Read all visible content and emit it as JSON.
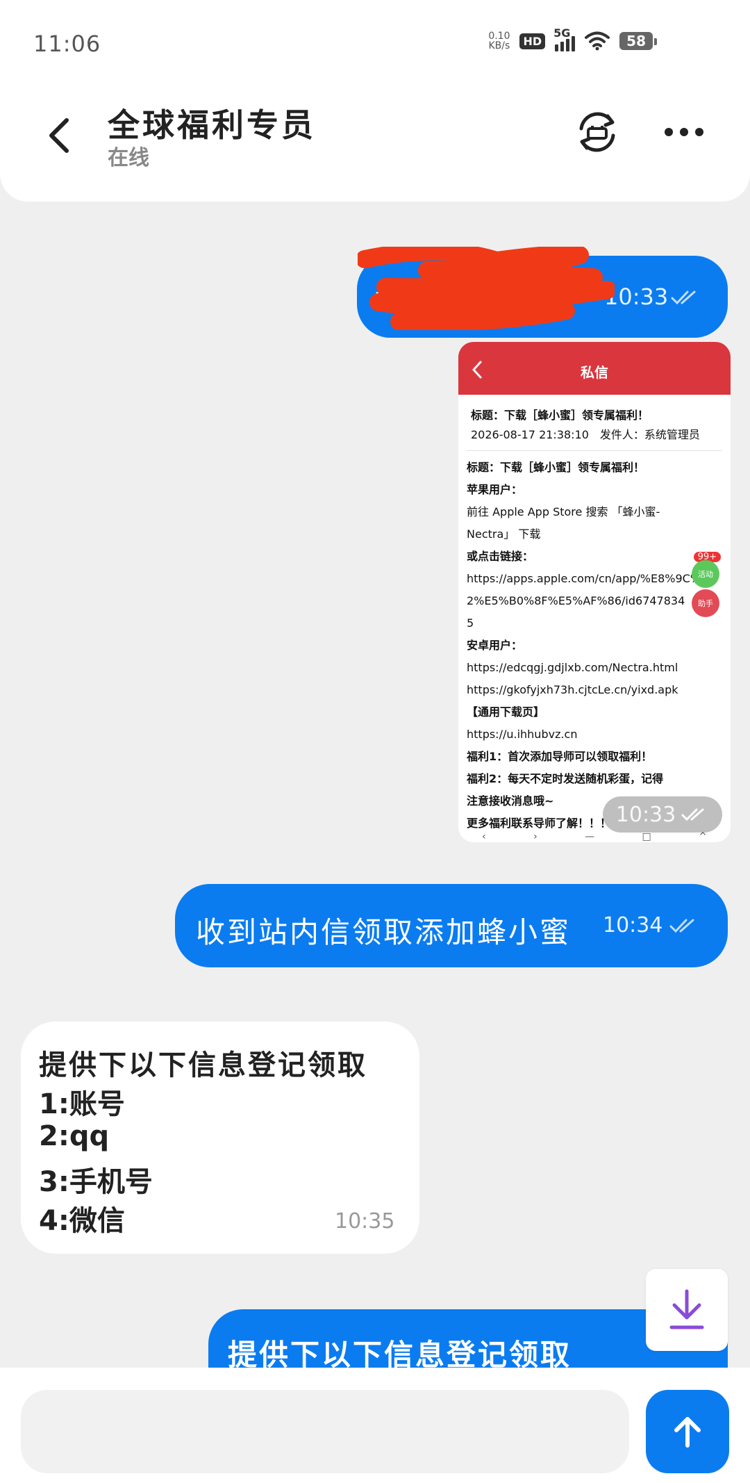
{
  "status_bar": {
    "time": "11:06",
    "net_speed_value": "0.10",
    "net_speed_unit": "KB/s",
    "hd_label": "HD",
    "network_label": "5G",
    "battery": "58"
  },
  "header": {
    "contact_name": "全球福利专员",
    "contact_status": "在线"
  },
  "messages": [
    {
      "direction": "outgoing",
      "text_visible": "w",
      "text_redacted": true,
      "time": "10:33",
      "read": true
    },
    {
      "direction": "outgoing",
      "type": "image",
      "screenshot": {
        "header_title": "私信",
        "meta_title": "标题：下载［蜂小蜜］领专属福利！",
        "meta_info": "2026-08-17 21:38:10　发件人：系统管理员",
        "lines": [
          "标题：下载［蜂小蜜］领专属福利！",
          "苹果用户：",
          "前往 Apple App Store 搜索 「蜂小蜜-",
          "Nectra」 下载",
          "或点击链接：",
          "https://apps.apple.com/cn/app/%E8%9C%82",
          "2%E5%B0%8F%E5%AF%86/id6747834",
          "5",
          "安卓用户：",
          "https://edcqgj.gdjlxb.com/Nectra.html",
          "https://gkofyjxh73h.cjtcLe.cn/yixd.apk",
          "【通用下载页】",
          "https://u.ihhubvz.cn",
          "福利1：首次添加导师可以领取福利！",
          "福利2：每天不定时发送随机彩蛋，记得",
          "注意接收消息哦~",
          "更多福利联系导师了解！！！"
        ],
        "badge_count": "99+",
        "badge_green": "活动",
        "badge_red": "助手",
        "time": "10:33"
      },
      "read": true
    },
    {
      "direction": "outgoing",
      "text": "收到站内信领取添加蜂小蜜",
      "time": "10:34",
      "read": true
    },
    {
      "direction": "incoming",
      "lines": [
        "提供下以下信息登记领取",
        "1:账号",
        "2:qq",
        "3:手机号",
        "4:微信"
      ],
      "time": "10:35"
    },
    {
      "direction": "outgoing",
      "text": "提供下以下信息登记领取"
    }
  ],
  "input": {
    "value": "",
    "placeholder": ""
  },
  "icons": {
    "back": "back-arrow-icon",
    "switch": "printer-sync-icon",
    "more": "more-dots-icon",
    "download": "download-icon",
    "send": "send-arrow-icon"
  },
  "colors": {
    "outgoing_bubble": "#0a7cf0",
    "incoming_bubble": "#ffffff",
    "background": "#efefef",
    "screenshot_header": "#d9363e",
    "redaction": "#f03a17"
  }
}
